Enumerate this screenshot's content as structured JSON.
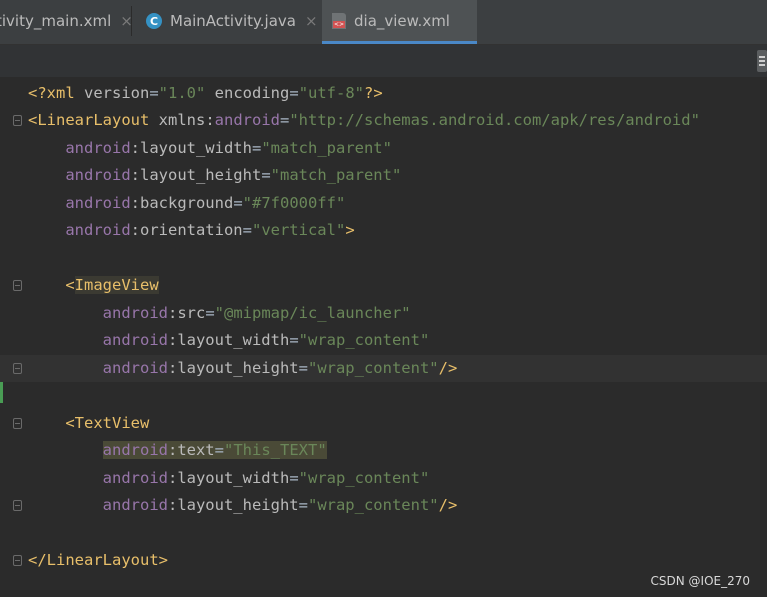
{
  "tabs": [
    {
      "label": "activity_main.xml",
      "display": "tivity_main.xml",
      "close": "×"
    },
    {
      "label": "MainActivity.java",
      "icon_letter": "C",
      "close": "×"
    },
    {
      "label": "dia_view.xml",
      "active": true
    }
  ],
  "editor": {
    "lines": {
      "l1": {
        "open": "<?xml ",
        "version_attr": "version",
        "eq1": "=",
        "version_val": "\"1.0\"",
        "enc_attr": " encoding",
        "eq2": "=",
        "enc_val": "\"utf-8\"",
        "close": "?>"
      },
      "l2": {
        "tag": "<LinearLayout ",
        "attr": "xmlns:",
        "ns": "android",
        "eq": "=",
        "val": "\"http://schemas.android.com/apk/res/android\""
      },
      "l3": {
        "ns": "android",
        "attr": ":layout_width",
        "eq": "=",
        "val": "\"match_parent\""
      },
      "l4": {
        "ns": "android",
        "attr": ":layout_height",
        "eq": "=",
        "val": "\"match_parent\""
      },
      "l5": {
        "ns": "android",
        "attr": ":background",
        "eq": "=",
        "val": "\"#7f0000ff\""
      },
      "l6": {
        "ns": "android",
        "attr": ":orientation",
        "eq": "=",
        "val": "\"vertical\"",
        "close": ">"
      },
      "l8": {
        "lt": "<",
        "tag": "ImageView"
      },
      "l9": {
        "ns": "android",
        "attr": ":src",
        "eq": "=",
        "val": "\"@mipmap/ic_launcher\""
      },
      "l10": {
        "ns": "android",
        "attr": ":layout_width",
        "eq": "=",
        "val": "\"wrap_content\""
      },
      "l11": {
        "ns": "android",
        "attr": ":layout_height",
        "eq": "=",
        "val": "\"wrap_content\"",
        "close": "/>"
      },
      "l13": {
        "tag": "<TextView"
      },
      "l14": {
        "ns": "android",
        "attr": ":text",
        "eq": "=",
        "val": "\"This_TEXT\""
      },
      "l15": {
        "ns": "android",
        "attr": ":layout_width",
        "eq": "=",
        "val": "\"wrap_content\""
      },
      "l16": {
        "ns": "android",
        "attr": ":layout_height",
        "eq": "=",
        "val": "\"wrap_content\"",
        "close": "/>"
      },
      "l18": {
        "tag": "</LinearLayout>"
      }
    }
  },
  "watermark": "CSDN @IOE_270",
  "colors": {
    "tag": "#e8bf6a",
    "namespace": "#9876aa",
    "attribute": "#bababa",
    "value": "#6a8759",
    "background": "#2b2b2b"
  }
}
